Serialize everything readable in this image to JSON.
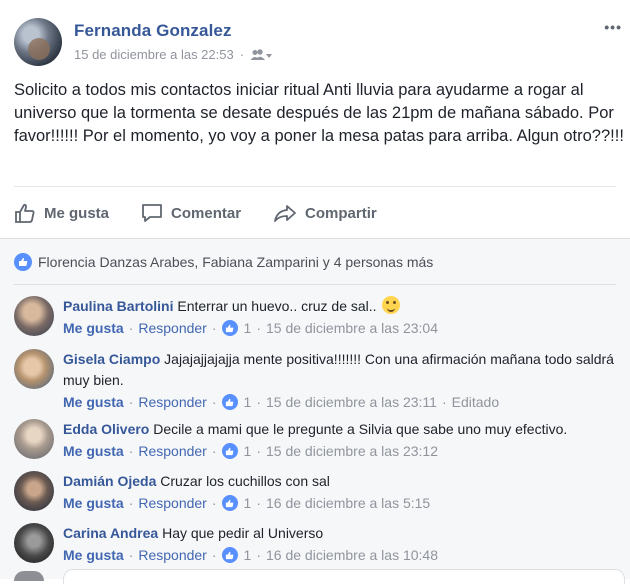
{
  "post": {
    "author": "Fernanda Gonzalez",
    "timestamp": "15 de diciembre a las 22:53",
    "audience_icon": "friends-icon",
    "body": "Solicito a todos mis contactos iniciar ritual Anti lluvia para ayudarme a rogar al universo que la tormenta se desate después de las 21pm de mañana sábado. Por favor!!!!!! Por el momento, yo voy a poner la mesa patas para arriba. Algun otro??!!!",
    "more_label": "•••"
  },
  "actions": {
    "like": "Me gusta",
    "comment": "Comentar",
    "share": "Compartir"
  },
  "reactions": {
    "text": "Florencia Danzas Arabes, Fabiana Zamparini y 4 personas más"
  },
  "comment_meta": {
    "like": "Me gusta",
    "reply": "Responder",
    "separator": "·"
  },
  "comments": [
    {
      "author": "Paulina Bartolini",
      "text": "Enterrar un huevo.. cruz de sal..",
      "likes": "1",
      "time": "15 de diciembre a las 23:04",
      "edited": ""
    },
    {
      "author": "Gisela Ciampo",
      "text": "Jajajajjajajja mente positiva!!!!!!! Con una afirmación mañana todo saldrá muy bien.",
      "likes": "1",
      "time": "15 de diciembre a las 23:11",
      "edited": "Editado"
    },
    {
      "author": "Edda Olivero",
      "text": "Decile a mami que le pregunte a Silvia que sabe uno muy efectivo.",
      "likes": "1",
      "time": "15 de diciembre a las 23:12",
      "edited": ""
    },
    {
      "author": "Damián Ojeda",
      "text": "Cruzar los cuchillos con sal",
      "likes": "1",
      "time": "16 de diciembre a las 5:15",
      "edited": ""
    },
    {
      "author": "Carina Andrea",
      "text": "Hay que pedir al Universo",
      "likes": "1",
      "time": "16 de diciembre a las 10:48",
      "edited": ""
    }
  ]
}
